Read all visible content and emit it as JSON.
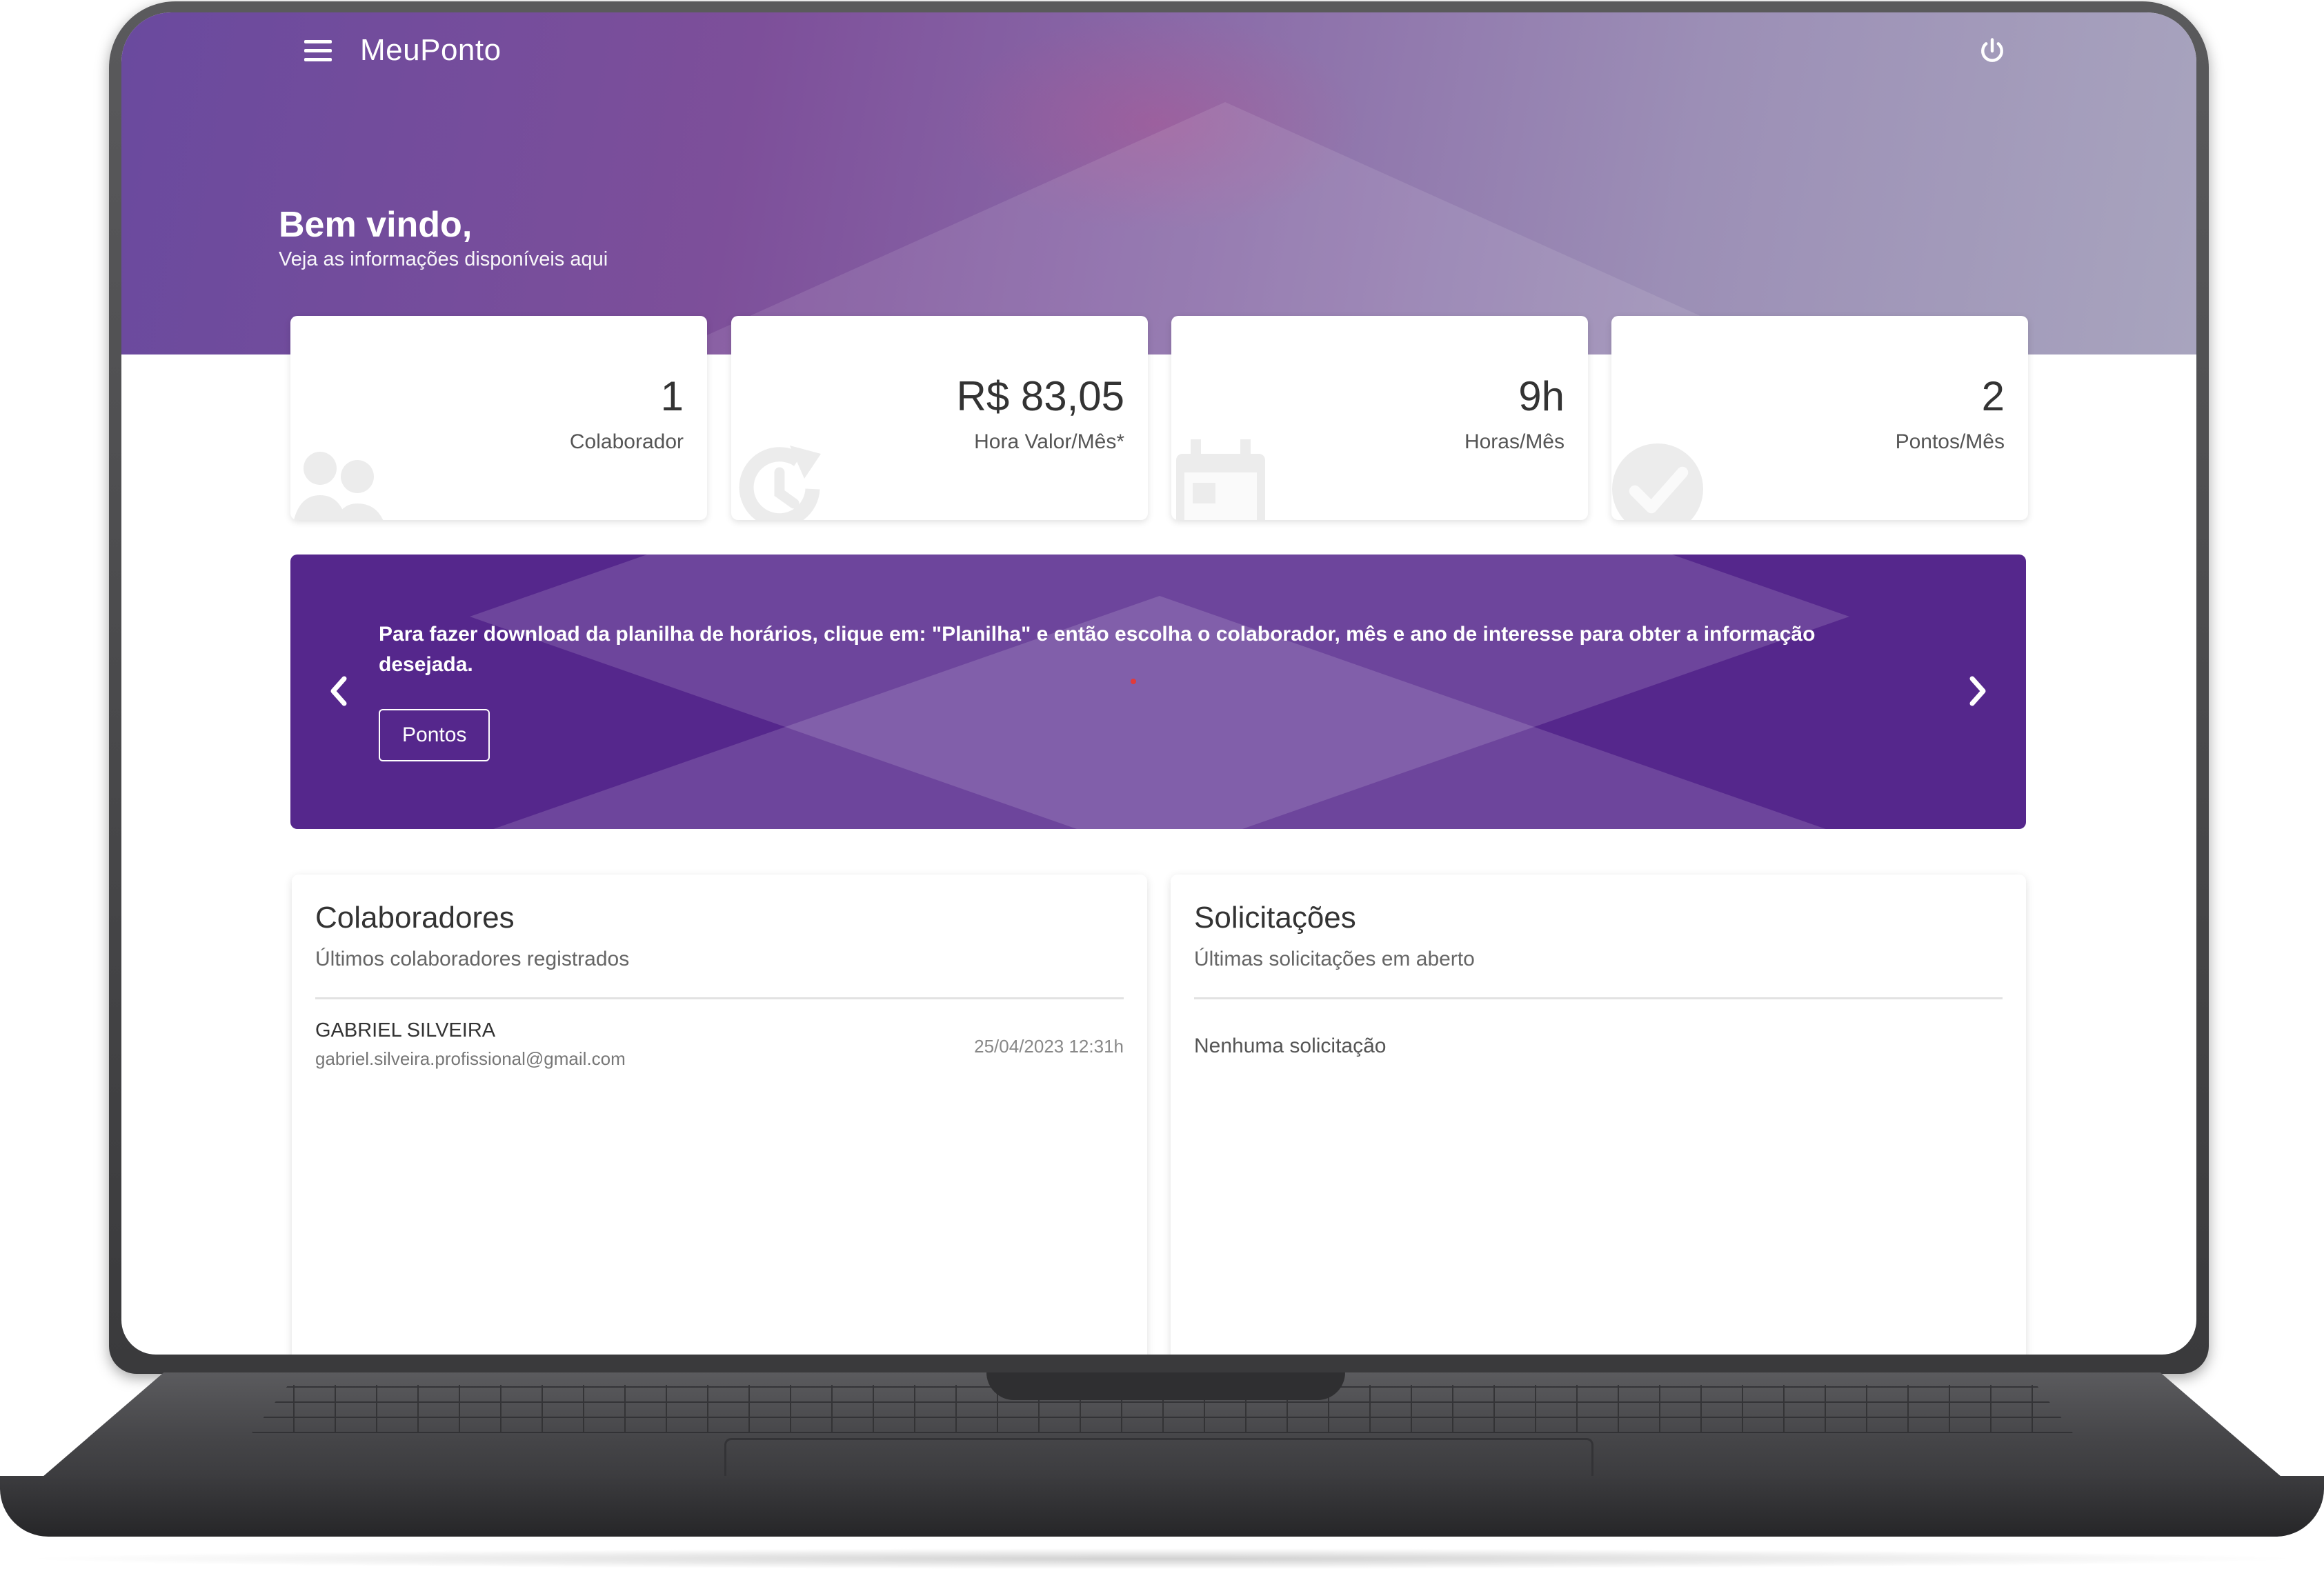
{
  "app": {
    "title": "MeuPonto"
  },
  "welcome": {
    "title": "Bem vindo,",
    "subtitle": "Veja as informações disponíveis aqui"
  },
  "stats": [
    {
      "value": "1",
      "label": "Colaborador",
      "icon": "users-icon"
    },
    {
      "value": "R$ 83,05",
      "label": "Hora Valor/Mês*",
      "icon": "clock-refresh-icon"
    },
    {
      "value": "9h",
      "label": "Horas/Mês",
      "icon": "calendar-icon"
    },
    {
      "value": "2",
      "label": "Pontos/Mês",
      "icon": "check-circle-icon"
    }
  ],
  "banner": {
    "message": "Para fazer download da planilha de horários, clique em: \"Planilha\" e então escolha o colaborador, mês e ano de interesse para obter a informação desejada.",
    "button_label": "Pontos"
  },
  "colaboradores": {
    "title": "Colaboradores",
    "subtitle": "Últimos colaboradores registrados",
    "rows": [
      {
        "name": "GABRIEL SILVEIRA",
        "email": "gabriel.silveira.profissional@gmail.com",
        "date": "25/04/2023 12:31h"
      }
    ]
  },
  "solicitacoes": {
    "title": "Solicitações",
    "subtitle": "Últimas solicitações em aberto",
    "empty_text": "Nenhuma solicitação"
  },
  "colors": {
    "primary": "#55278c",
    "hero_start": "#6a4a9e",
    "text_dark": "#333333"
  }
}
